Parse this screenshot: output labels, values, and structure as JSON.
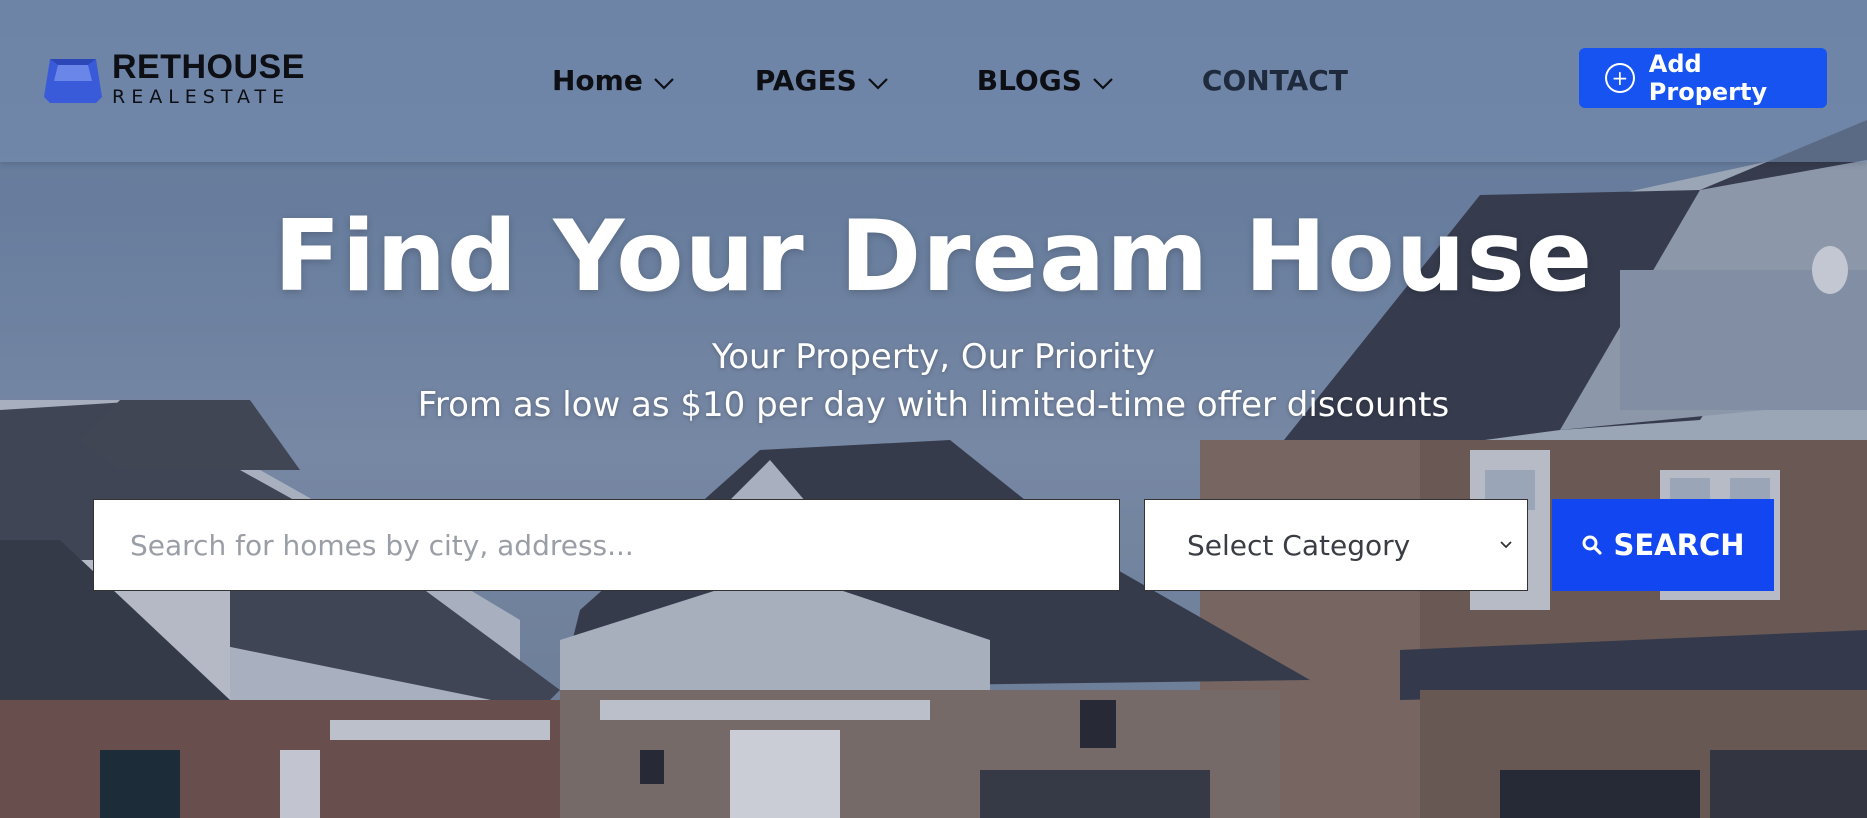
{
  "brand": {
    "name_line1": "RETHOUSE",
    "name_line2": "REALESTATE",
    "logo_color": "#3a5bd9"
  },
  "nav": {
    "items": [
      {
        "label": "Home",
        "has_dropdown": true
      },
      {
        "label": "PAGES",
        "has_dropdown": true
      },
      {
        "label": "BLOGS",
        "has_dropdown": true
      },
      {
        "label": "CONTACT",
        "has_dropdown": false
      }
    ],
    "add_property_label": "Add Property",
    "add_property_icon": "plus-circle-icon"
  },
  "hero": {
    "title": "Find Your Dream House",
    "subtitle1": "Your Property, Our Priority",
    "subtitle2": "From as low as $10 per day with limited-time offer discounts"
  },
  "search": {
    "placeholder": "Search for homes by city, address...",
    "value": "",
    "category_selected": "Select Category",
    "button_label": "SEARCH",
    "button_icon": "search-icon"
  },
  "colors": {
    "accent": "#1653f0",
    "text_dark": "#0d0f14",
    "white": "#ffffff"
  }
}
